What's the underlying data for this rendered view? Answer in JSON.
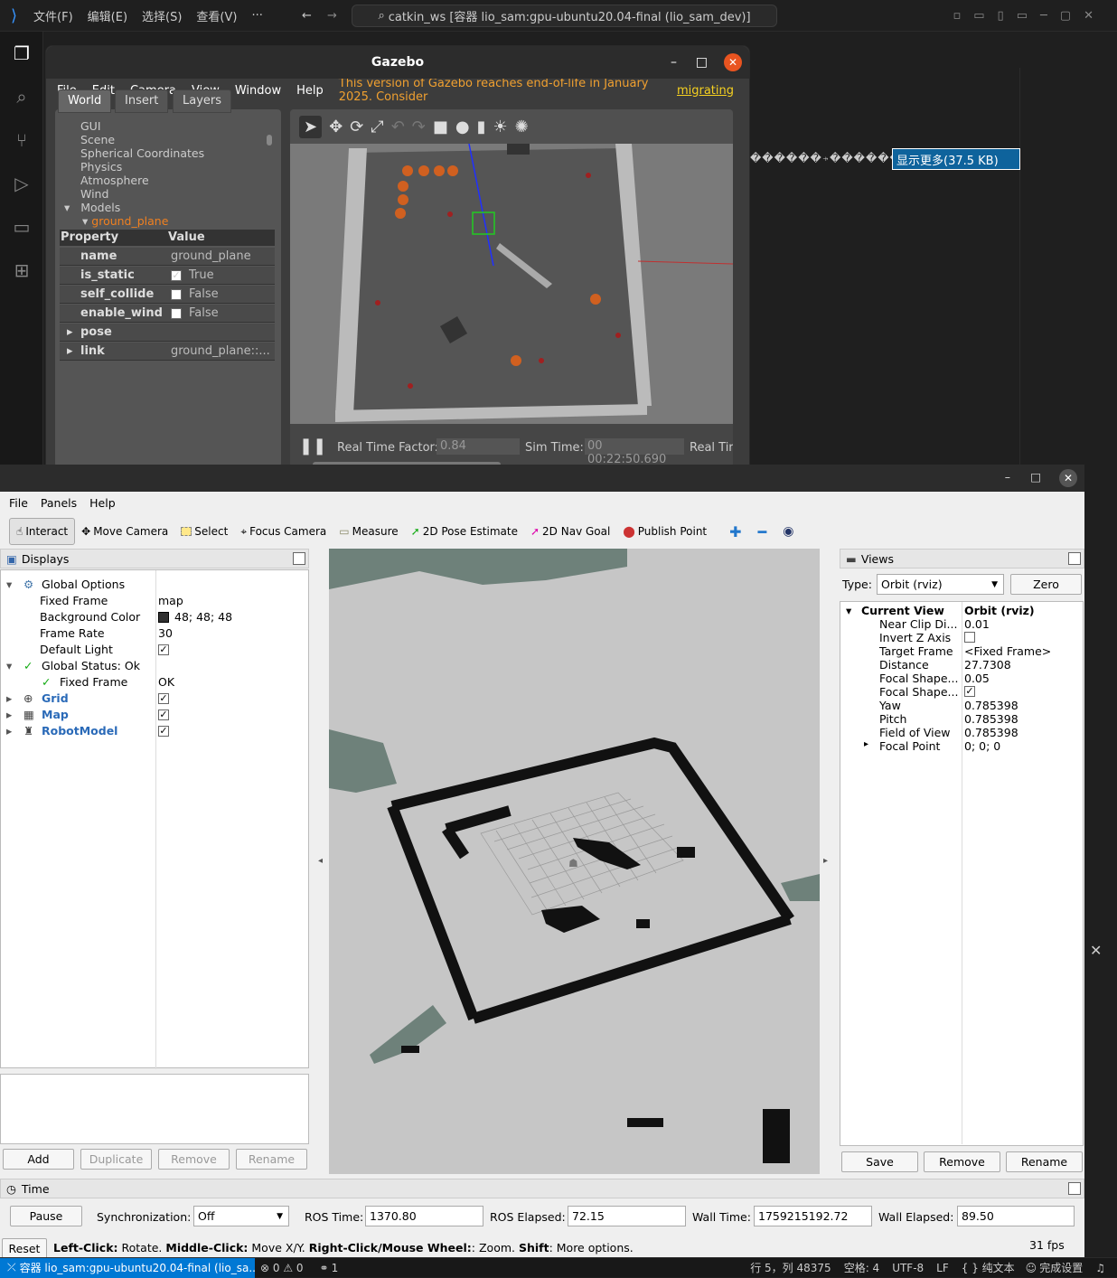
{
  "vscode": {
    "menus": [
      "文件(F)",
      "编辑(E)",
      "选择(S)",
      "查看(V)",
      "···"
    ],
    "search": "catkin_ws [容器 lio_sam:gpu-ubuntu20.04-final (lio_sam_dev)]",
    "show_more": "显示更多(37.5 KB)",
    "garbled": "������⍆������������",
    "status": {
      "remote": "容器 lio_sam:gpu-ubuntu20.04-final (lio_sa...",
      "problems": "⊗ 0 ⚠ 0",
      "ports": "1",
      "position": "行 5，列 48375",
      "spaces": "空格: 4",
      "encoding": "UTF-8",
      "eol": "LF",
      "language": "{ } 纯文本",
      "done": "完成设置"
    }
  },
  "gazebo": {
    "title": "Gazebo",
    "menu": [
      "File",
      "Edit",
      "Camera",
      "View",
      "Window",
      "Help"
    ],
    "warning": "This version of Gazebo reaches end-of-life in January 2025. Consider",
    "warning_link": "migrating",
    "tabs": [
      "World",
      "Insert",
      "Layers"
    ],
    "tree": [
      "GUI",
      "Scene",
      "Spherical Coordinates",
      "Physics",
      "Atmosphere",
      "Wind",
      "Models"
    ],
    "selected_model": "ground_plane",
    "prop_header": {
      "k": "Property",
      "v": "Value"
    },
    "props": [
      {
        "k": "name",
        "v": "ground_plane",
        "cb": ""
      },
      {
        "k": "is_static",
        "v": "True",
        "cb": "✓"
      },
      {
        "k": "self_collide",
        "v": "False",
        "cb": " "
      },
      {
        "k": "enable_wind",
        "v": "False",
        "cb": " "
      },
      {
        "k": "pose",
        "v": "",
        "cb": ""
      },
      {
        "k": "link",
        "v": "ground_plane::...",
        "cb": ""
      }
    ],
    "rtf_label": "Real Time Factor:",
    "rtf": "0.84",
    "sim_label": "Sim Time:",
    "sim_time": "00 00:22:50.690",
    "real_label": "Real Tir"
  },
  "rviz": {
    "menu": [
      "File",
      "Panels",
      "Help"
    ],
    "tools": [
      "Interact",
      "Move Camera",
      "Select",
      "Focus Camera",
      "Measure",
      "2D Pose Estimate",
      "2D Nav Goal",
      "Publish Point"
    ],
    "displays_title": "Displays",
    "displays": [
      {
        "name": "Global Options",
        "value": "",
        "indent": 1
      },
      {
        "name": "Fixed Frame",
        "value": "map",
        "indent": 2
      },
      {
        "name": "Background Color",
        "value": "48; 48; 48",
        "indent": 2
      },
      {
        "name": "Frame Rate",
        "value": "30",
        "indent": 2
      },
      {
        "name": "Default Light",
        "value": "✓",
        "indent": 2
      },
      {
        "name": "Global Status: Ok",
        "value": "",
        "indent": 1
      },
      {
        "name": "Fixed Frame",
        "value": "OK",
        "indent": 2
      },
      {
        "name": "Grid",
        "value": "✓",
        "indent": 1
      },
      {
        "name": "Map",
        "value": "✓",
        "indent": 1
      },
      {
        "name": "RobotModel",
        "value": "✓",
        "indent": 1
      }
    ],
    "display_buttons": [
      "Add",
      "Duplicate",
      "Remove",
      "Rename"
    ],
    "views_title": "Views",
    "type_label": "Type:",
    "type_value": "Orbit (rviz)",
    "zero": "Zero",
    "current_view": {
      "name": "Current View",
      "value": "Orbit (rviz)"
    },
    "view_props": [
      {
        "name": "Near Clip Di...",
        "value": "0.01"
      },
      {
        "name": "Invert Z Axis",
        "value": " "
      },
      {
        "name": "Target Frame",
        "value": "<Fixed Frame>"
      },
      {
        "name": "Distance",
        "value": "27.7308"
      },
      {
        "name": "Focal Shape...",
        "value": "0.05"
      },
      {
        "name": "Focal Shape...",
        "value": "✓"
      },
      {
        "name": "Yaw",
        "value": "0.785398"
      },
      {
        "name": "Pitch",
        "value": "0.785398"
      },
      {
        "name": "Field of View",
        "value": "0.785398"
      },
      {
        "name": "Focal Point",
        "value": "0; 0; 0"
      }
    ],
    "view_buttons": [
      "Save",
      "Remove",
      "Rename"
    ],
    "time_title": "Time",
    "pause": "Pause",
    "sync_label": "Synchronization:",
    "sync_value": "Off",
    "ros_time_label": "ROS Time:",
    "ros_time": "1370.80",
    "ros_elapsed_label": "ROS Elapsed:",
    "ros_elapsed": "72.15",
    "wall_time_label": "Wall Time:",
    "wall_time": "1759215192.72",
    "wall_elapsed_label": "Wall Elapsed:",
    "wall_elapsed": "89.50",
    "reset": "Reset",
    "help_left": "Left-Click:",
    "help_left_t": " Rotate. ",
    "help_mid": "Middle-Click:",
    "help_mid_t": " Move X/Y. ",
    "help_right": "Right-Click/Mouse Wheel:",
    "help_right_t": ": Zoom. ",
    "help_shift": "Shift",
    "help_shift_t": ": More options.",
    "fps": "31 fps"
  }
}
